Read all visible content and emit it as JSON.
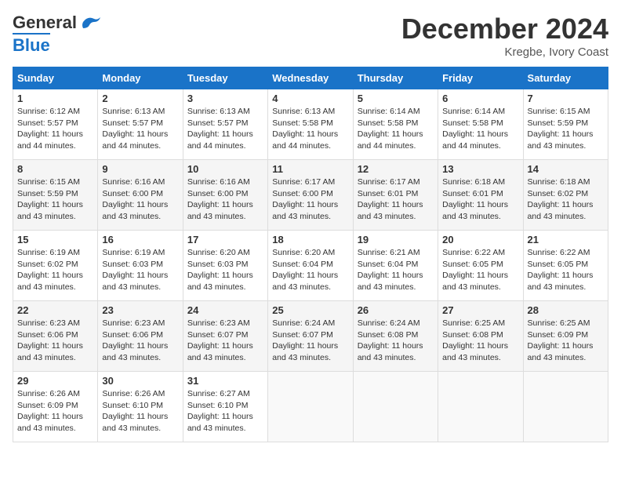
{
  "header": {
    "logo_line1": "General",
    "logo_line2": "Blue",
    "month_title": "December 2024",
    "location": "Kregbe, Ivory Coast"
  },
  "days_of_week": [
    "Sunday",
    "Monday",
    "Tuesday",
    "Wednesday",
    "Thursday",
    "Friday",
    "Saturday"
  ],
  "weeks": [
    [
      {
        "day": "1",
        "sunrise": "6:12 AM",
        "sunset": "5:57 PM",
        "daylight": "11 hours and 44 minutes."
      },
      {
        "day": "2",
        "sunrise": "6:13 AM",
        "sunset": "5:57 PM",
        "daylight": "11 hours and 44 minutes."
      },
      {
        "day": "3",
        "sunrise": "6:13 AM",
        "sunset": "5:57 PM",
        "daylight": "11 hours and 44 minutes."
      },
      {
        "day": "4",
        "sunrise": "6:13 AM",
        "sunset": "5:58 PM",
        "daylight": "11 hours and 44 minutes."
      },
      {
        "day": "5",
        "sunrise": "6:14 AM",
        "sunset": "5:58 PM",
        "daylight": "11 hours and 44 minutes."
      },
      {
        "day": "6",
        "sunrise": "6:14 AM",
        "sunset": "5:58 PM",
        "daylight": "11 hours and 44 minutes."
      },
      {
        "day": "7",
        "sunrise": "6:15 AM",
        "sunset": "5:59 PM",
        "daylight": "11 hours and 43 minutes."
      }
    ],
    [
      {
        "day": "8",
        "sunrise": "6:15 AM",
        "sunset": "5:59 PM",
        "daylight": "11 hours and 43 minutes."
      },
      {
        "day": "9",
        "sunrise": "6:16 AM",
        "sunset": "6:00 PM",
        "daylight": "11 hours and 43 minutes."
      },
      {
        "day": "10",
        "sunrise": "6:16 AM",
        "sunset": "6:00 PM",
        "daylight": "11 hours and 43 minutes."
      },
      {
        "day": "11",
        "sunrise": "6:17 AM",
        "sunset": "6:00 PM",
        "daylight": "11 hours and 43 minutes."
      },
      {
        "day": "12",
        "sunrise": "6:17 AM",
        "sunset": "6:01 PM",
        "daylight": "11 hours and 43 minutes."
      },
      {
        "day": "13",
        "sunrise": "6:18 AM",
        "sunset": "6:01 PM",
        "daylight": "11 hours and 43 minutes."
      },
      {
        "day": "14",
        "sunrise": "6:18 AM",
        "sunset": "6:02 PM",
        "daylight": "11 hours and 43 minutes."
      }
    ],
    [
      {
        "day": "15",
        "sunrise": "6:19 AM",
        "sunset": "6:02 PM",
        "daylight": "11 hours and 43 minutes."
      },
      {
        "day": "16",
        "sunrise": "6:19 AM",
        "sunset": "6:03 PM",
        "daylight": "11 hours and 43 minutes."
      },
      {
        "day": "17",
        "sunrise": "6:20 AM",
        "sunset": "6:03 PM",
        "daylight": "11 hours and 43 minutes."
      },
      {
        "day": "18",
        "sunrise": "6:20 AM",
        "sunset": "6:04 PM",
        "daylight": "11 hours and 43 minutes."
      },
      {
        "day": "19",
        "sunrise": "6:21 AM",
        "sunset": "6:04 PM",
        "daylight": "11 hours and 43 minutes."
      },
      {
        "day": "20",
        "sunrise": "6:22 AM",
        "sunset": "6:05 PM",
        "daylight": "11 hours and 43 minutes."
      },
      {
        "day": "21",
        "sunrise": "6:22 AM",
        "sunset": "6:05 PM",
        "daylight": "11 hours and 43 minutes."
      }
    ],
    [
      {
        "day": "22",
        "sunrise": "6:23 AM",
        "sunset": "6:06 PM",
        "daylight": "11 hours and 43 minutes."
      },
      {
        "day": "23",
        "sunrise": "6:23 AM",
        "sunset": "6:06 PM",
        "daylight": "11 hours and 43 minutes."
      },
      {
        "day": "24",
        "sunrise": "6:23 AM",
        "sunset": "6:07 PM",
        "daylight": "11 hours and 43 minutes."
      },
      {
        "day": "25",
        "sunrise": "6:24 AM",
        "sunset": "6:07 PM",
        "daylight": "11 hours and 43 minutes."
      },
      {
        "day": "26",
        "sunrise": "6:24 AM",
        "sunset": "6:08 PM",
        "daylight": "11 hours and 43 minutes."
      },
      {
        "day": "27",
        "sunrise": "6:25 AM",
        "sunset": "6:08 PM",
        "daylight": "11 hours and 43 minutes."
      },
      {
        "day": "28",
        "sunrise": "6:25 AM",
        "sunset": "6:09 PM",
        "daylight": "11 hours and 43 minutes."
      }
    ],
    [
      {
        "day": "29",
        "sunrise": "6:26 AM",
        "sunset": "6:09 PM",
        "daylight": "11 hours and 43 minutes."
      },
      {
        "day": "30",
        "sunrise": "6:26 AM",
        "sunset": "6:10 PM",
        "daylight": "11 hours and 43 minutes."
      },
      {
        "day": "31",
        "sunrise": "6:27 AM",
        "sunset": "6:10 PM",
        "daylight": "11 hours and 43 minutes."
      },
      null,
      null,
      null,
      null
    ]
  ]
}
